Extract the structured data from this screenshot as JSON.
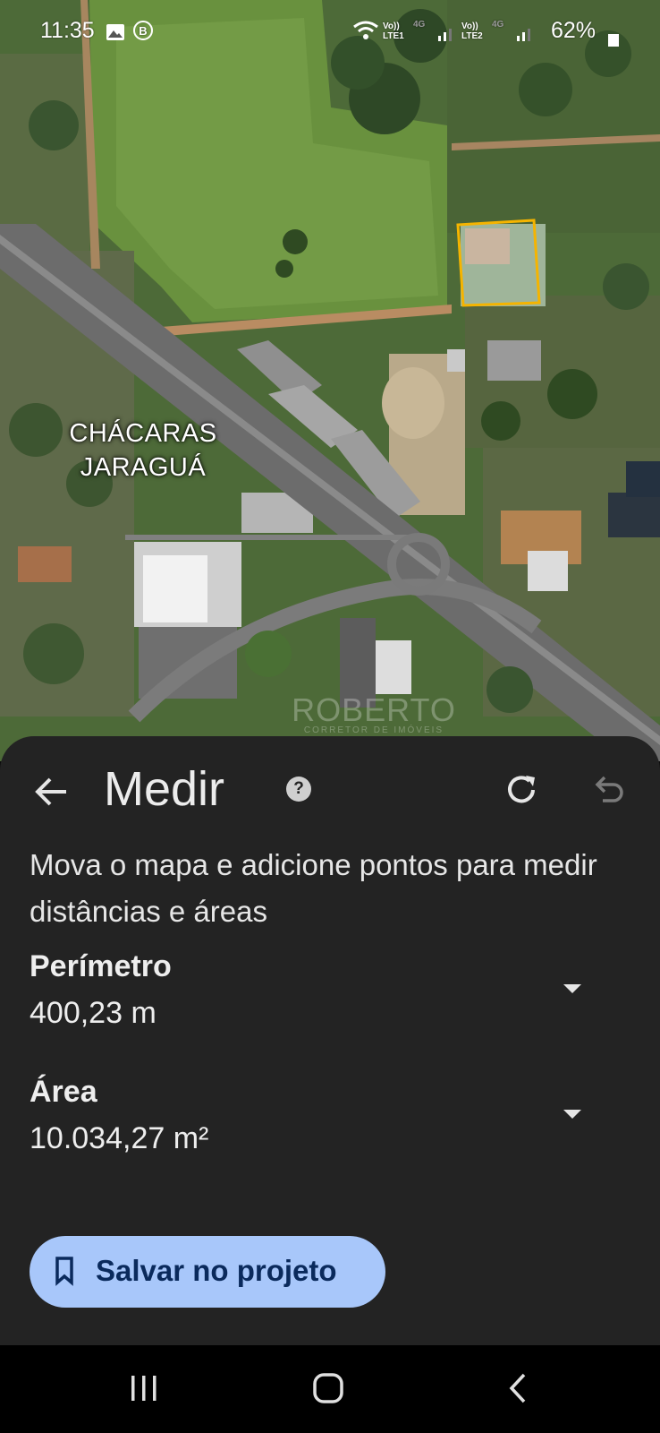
{
  "status_bar": {
    "time": "11:35",
    "sim1_top": "Vo))",
    "sim1_bottom": "LTE1",
    "sim1_net": "4G",
    "sim2_top": "Vo))",
    "sim2_bottom": "LTE2",
    "sim2_net": "4G",
    "battery": "62%",
    "icons": [
      "gallery-icon",
      "b-badge-icon",
      "wifi-icon",
      "signal-icon",
      "battery-icon"
    ]
  },
  "map": {
    "place_label_line1": "CHÁCARAS",
    "place_label_line2": "JARAGUÁ",
    "watermark_name": "ROBERTO",
    "watermark_sub": "CORRETOR DE IMÓVEIS",
    "measure_outline_color": "#f5b400"
  },
  "sheet": {
    "title": "Medir",
    "instruction": "Mova o mapa e adicione pontos para medir distâncias e áreas",
    "perimeter_label": "Perímetro",
    "perimeter_value": "400,23 m",
    "area_label": "Área",
    "area_value": "10.034,27 m²",
    "save_label": "Salvar no projeto",
    "icons": [
      "back-arrow-icon",
      "help-icon",
      "redo-icon",
      "undo-icon",
      "chevron-down-icon",
      "bookmark-icon"
    ]
  },
  "colors": {
    "sheet_bg": "#232323",
    "button_bg": "#a8c7fa",
    "button_text": "#0a2a5c"
  }
}
